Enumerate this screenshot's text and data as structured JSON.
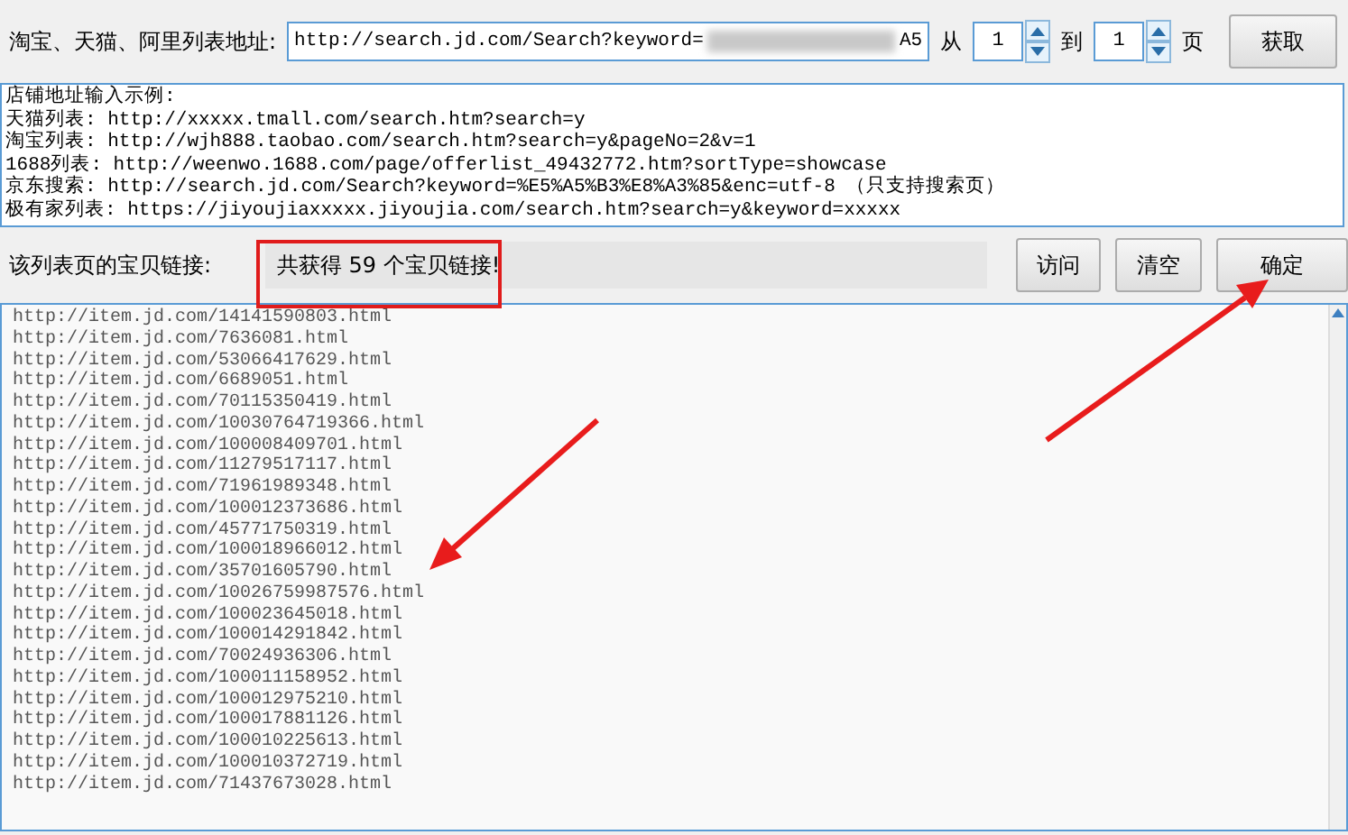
{
  "url_bar": {
    "label": "淘宝、天猫、阿里列表地址:",
    "value": "http://search.jd.com/Search?keyword=",
    "value_tail": "A5",
    "from_label": "从",
    "from_value": "1",
    "to_label": "到",
    "to_value": "1",
    "page_label": "页",
    "fetch_button": "获取"
  },
  "examples": [
    "店铺地址输入示例:",
    "天猫列表: http://xxxxx.tmall.com/search.htm?search=y",
    "淘宝列表: http://wjh888.taobao.com/search.htm?search=y&pageNo=2&v=1",
    "1688列表: http://weenwo.1688.com/page/offerlist_49432772.htm?sortType=showcase",
    "京东搜索: http://search.jd.com/Search?keyword=%E5%A5%B3%E8%A3%85&enc=utf-8 （只支持搜索页）",
    "极有家列表: https://jiyoujiaxxxxx.jiyoujia.com/search.htm?search=y&keyword=xxxxx"
  ],
  "result_bar": {
    "label": "该列表页的宝贝链接:",
    "count": "共获得 59 个宝贝链接!",
    "buttons": [
      "访问",
      "清空",
      "确定"
    ]
  },
  "links": [
    "http://item.jd.com/14141590803.html",
    "http://item.jd.com/7636081.html",
    "http://item.jd.com/53066417629.html",
    "http://item.jd.com/6689051.html",
    "http://item.jd.com/70115350419.html",
    "http://item.jd.com/10030764719366.html",
    "http://item.jd.com/100008409701.html",
    "http://item.jd.com/11279517117.html",
    "http://item.jd.com/71961989348.html",
    "http://item.jd.com/100012373686.html",
    "http://item.jd.com/45771750319.html",
    "http://item.jd.com/100018966012.html",
    "http://item.jd.com/35701605790.html",
    "http://item.jd.com/10026759987576.html",
    "http://item.jd.com/100023645018.html",
    "http://item.jd.com/100014291842.html",
    "http://item.jd.com/70024936306.html",
    "http://item.jd.com/100011158952.html",
    "http://item.jd.com/100012975210.html",
    "http://item.jd.com/100017881126.html",
    "http://item.jd.com/100010225613.html",
    "http://item.jd.com/100010372719.html",
    "http://item.jd.com/71437673028.html"
  ]
}
